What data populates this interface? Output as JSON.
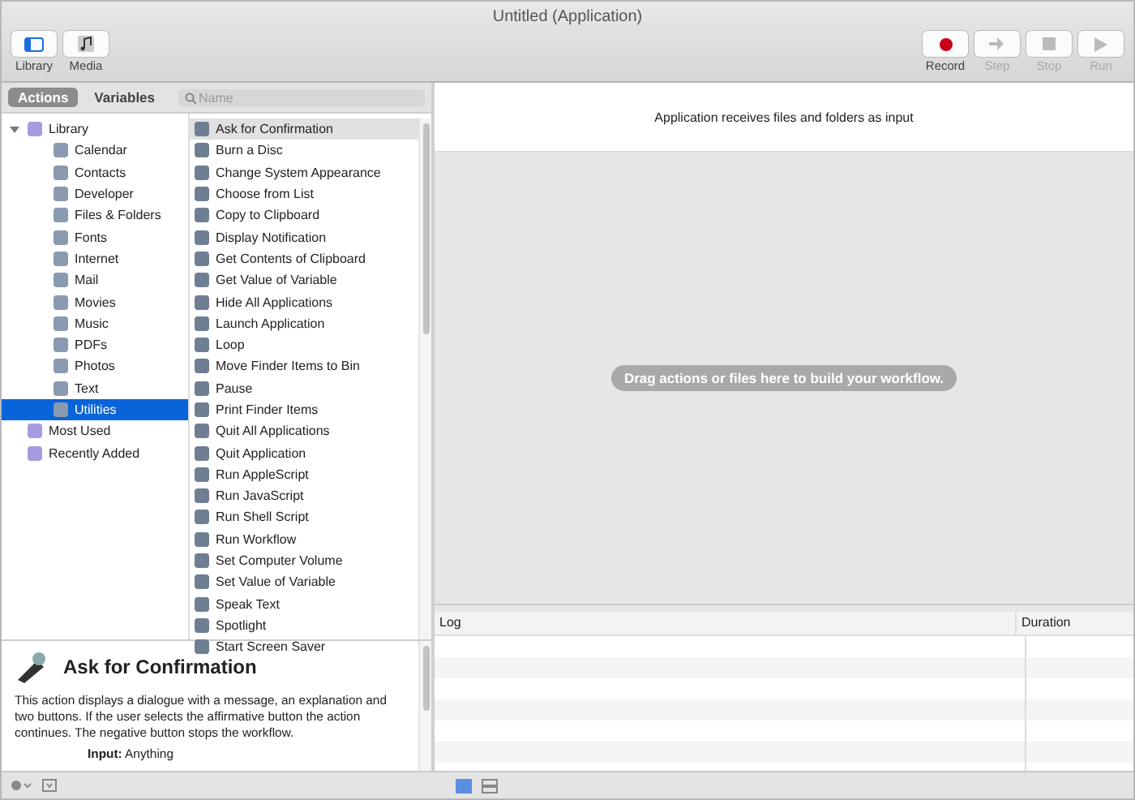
{
  "window": {
    "title": "Untitled (Application)"
  },
  "toolbar": {
    "left": [
      {
        "label": "Library",
        "disabled": false
      },
      {
        "label": "Media",
        "disabled": false
      }
    ],
    "right": [
      {
        "label": "Record",
        "kind": "record",
        "disabled": false
      },
      {
        "label": "Step",
        "kind": "step",
        "disabled": true
      },
      {
        "label": "Stop",
        "kind": "stop",
        "disabled": true
      },
      {
        "label": "Run",
        "kind": "run",
        "disabled": true
      }
    ]
  },
  "tabs": [
    {
      "label": "Actions",
      "selected": true
    },
    {
      "label": "Variables",
      "selected": false
    }
  ],
  "search": {
    "placeholder": "Name"
  },
  "library": [
    {
      "label": "Library",
      "selected": false,
      "expanded": true,
      "children": [
        {
          "label": "Calendar",
          "selected": false
        },
        {
          "label": "Contacts",
          "selected": false
        },
        {
          "label": "Developer",
          "selected": false
        },
        {
          "label": "Files & Folders",
          "selected": false
        },
        {
          "label": "Fonts",
          "selected": false
        },
        {
          "label": "Internet",
          "selected": false
        },
        {
          "label": "Mail",
          "selected": false
        },
        {
          "label": "Movies",
          "selected": false
        },
        {
          "label": "Music",
          "selected": false
        },
        {
          "label": "PDFs",
          "selected": false
        },
        {
          "label": "Photos",
          "selected": false
        },
        {
          "label": "Text",
          "selected": false
        },
        {
          "label": "Utilities",
          "selected": true
        }
      ]
    },
    {
      "label": "Most Used",
      "selected": false
    },
    {
      "label": "Recently Added",
      "selected": false
    }
  ],
  "actions": [
    {
      "label": "Ask for Confirmation",
      "selected": true
    },
    {
      "label": "Burn a Disc",
      "selected": false
    },
    {
      "label": "Change System Appearance",
      "selected": false
    },
    {
      "label": "Choose from List",
      "selected": false
    },
    {
      "label": "Copy to Clipboard",
      "selected": false
    },
    {
      "label": "Display Notification",
      "selected": false
    },
    {
      "label": "Get Contents of Clipboard",
      "selected": false
    },
    {
      "label": "Get Value of Variable",
      "selected": false
    },
    {
      "label": "Hide All Applications",
      "selected": false
    },
    {
      "label": "Launch Application",
      "selected": false
    },
    {
      "label": "Loop",
      "selected": false
    },
    {
      "label": "Move Finder Items to Bin",
      "selected": false
    },
    {
      "label": "Pause",
      "selected": false
    },
    {
      "label": "Print Finder Items",
      "selected": false
    },
    {
      "label": "Quit All Applications",
      "selected": false
    },
    {
      "label": "Quit Application",
      "selected": false
    },
    {
      "label": "Run AppleScript",
      "selected": false
    },
    {
      "label": "Run JavaScript",
      "selected": false
    },
    {
      "label": "Run Shell Script",
      "selected": false
    },
    {
      "label": "Run Workflow",
      "selected": false
    },
    {
      "label": "Set Computer Volume",
      "selected": false
    },
    {
      "label": "Set Value of Variable",
      "selected": false
    },
    {
      "label": "Speak Text",
      "selected": false
    },
    {
      "label": "Spotlight",
      "selected": false
    },
    {
      "label": "Start Screen Saver",
      "selected": false
    }
  ],
  "description": {
    "title": "Ask for Confirmation",
    "body": "This action displays a dialogue with a message, an explanation and two buttons. If the user selects the affirmative button the action continues. The negative button stops the workflow.",
    "input": "**Input:** Anything"
  },
  "workflow": {
    "header": "Application receives files and folders as input",
    "hint": "Drag actions or files here to build your workflow."
  },
  "log": {
    "columns": [
      "Log",
      "Duration"
    ]
  }
}
